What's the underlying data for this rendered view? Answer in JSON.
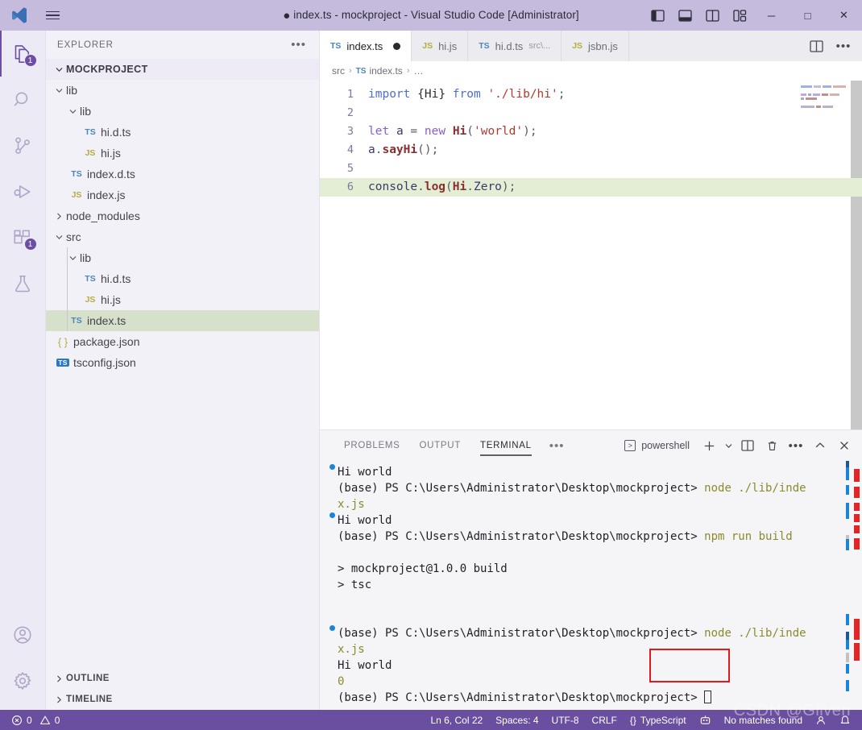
{
  "window": {
    "title": "index.ts - mockproject - Visual Studio Code [Administrator]",
    "dirty_marker": "●",
    "minimize": "─",
    "maximize": "□",
    "close": "✕",
    "titlebar_color": "#c4bbdd"
  },
  "activitybar": {
    "items": [
      {
        "name": "explorer",
        "badge": "1",
        "active": true
      },
      {
        "name": "search",
        "badge": "",
        "active": false
      },
      {
        "name": "source-control",
        "badge": "",
        "active": false
      },
      {
        "name": "run-and-debug",
        "badge": "",
        "active": false
      },
      {
        "name": "extensions",
        "badge": "1",
        "active": false
      },
      {
        "name": "testing",
        "badge": "",
        "active": false
      }
    ],
    "bottom": [
      {
        "name": "accounts"
      },
      {
        "name": "manage-settings"
      }
    ]
  },
  "sidebar": {
    "header": "EXPLORER",
    "more_label": "•••",
    "root": "MOCKPROJECT",
    "tree": [
      {
        "label": "lib",
        "kind": "folder",
        "indent": 1,
        "expanded": true,
        "selected": false
      },
      {
        "label": "lib",
        "kind": "folder",
        "indent": 2,
        "expanded": true,
        "selected": false
      },
      {
        "label": "hi.d.ts",
        "kind": "ts",
        "indent": 3,
        "selected": false
      },
      {
        "label": "hi.js",
        "kind": "js",
        "indent": 3,
        "selected": false
      },
      {
        "label": "index.d.ts",
        "kind": "ts",
        "indent": 2,
        "selected": false
      },
      {
        "label": "index.js",
        "kind": "js",
        "indent": 2,
        "selected": false
      },
      {
        "label": "node_modules",
        "kind": "folder",
        "indent": 1,
        "expanded": false,
        "selected": false
      },
      {
        "label": "src",
        "kind": "folder",
        "indent": 1,
        "expanded": true,
        "selected": false
      },
      {
        "label": "lib",
        "kind": "folder",
        "indent": 2,
        "expanded": true,
        "selected": false
      },
      {
        "label": "hi.d.ts",
        "kind": "ts",
        "indent": 3,
        "selected": false
      },
      {
        "label": "hi.js",
        "kind": "js",
        "indent": 3,
        "selected": false
      },
      {
        "label": "index.ts",
        "kind": "ts",
        "indent": 2,
        "selected": true
      },
      {
        "label": "package.json",
        "kind": "json",
        "indent": 1,
        "selected": false
      },
      {
        "label": "tsconfig.json",
        "kind": "tsconf",
        "indent": 1,
        "selected": false
      }
    ],
    "sections": [
      {
        "label": "OUTLINE"
      },
      {
        "label": "TIMELINE"
      }
    ]
  },
  "editor": {
    "tabs": [
      {
        "label": "index.ts",
        "icon": "TS",
        "desc": "",
        "active": true,
        "dirty": true
      },
      {
        "label": "hi.js",
        "icon": "JS",
        "desc": "",
        "active": false,
        "dirty": false
      },
      {
        "label": "hi.d.ts",
        "icon": "TS",
        "desc": "src\\...",
        "active": false,
        "dirty": false
      },
      {
        "label": "jsbn.js",
        "icon": "JS",
        "desc": "",
        "active": false,
        "dirty": false
      }
    ],
    "actions": [
      {
        "name": "split-editor-right"
      },
      {
        "name": "more-editor-actions",
        "label": "•••"
      }
    ],
    "breadcrumb": [
      {
        "label": "src",
        "icon": ""
      },
      {
        "label": "index.ts",
        "icon": "TS"
      },
      {
        "label": "…",
        "icon": ""
      }
    ],
    "lines": [
      {
        "num": "1",
        "highlight": false,
        "tokens": [
          {
            "t": "import",
            "c": "k-import"
          },
          {
            "t": " ",
            "c": "k-plain"
          },
          {
            "t": "{Hi}",
            "c": "k-plain"
          },
          {
            "t": " ",
            "c": "k-plain"
          },
          {
            "t": "from",
            "c": "k-import"
          },
          {
            "t": " ",
            "c": "k-plain"
          },
          {
            "t": "'./lib/hi'",
            "c": "k-str"
          },
          {
            "t": ";",
            "c": "k-punc"
          }
        ]
      },
      {
        "num": "2",
        "highlight": false,
        "tokens": []
      },
      {
        "num": "3",
        "highlight": false,
        "tokens": [
          {
            "t": "let",
            "c": "k-kw"
          },
          {
            "t": " ",
            "c": "k-plain"
          },
          {
            "t": "a",
            "c": "k-var"
          },
          {
            "t": " = ",
            "c": "k-punc"
          },
          {
            "t": "new",
            "c": "k-kw"
          },
          {
            "t": " ",
            "c": "k-plain"
          },
          {
            "t": "Hi",
            "c": "k-cls"
          },
          {
            "t": "(",
            "c": "k-punc"
          },
          {
            "t": "'world'",
            "c": "k-str"
          },
          {
            "t": ")",
            "c": "k-punc"
          },
          {
            "t": ";",
            "c": "k-punc"
          }
        ]
      },
      {
        "num": "4",
        "highlight": false,
        "tokens": [
          {
            "t": "a",
            "c": "k-var"
          },
          {
            "t": ".",
            "c": "k-punc"
          },
          {
            "t": "sayHi",
            "c": "k-fn"
          },
          {
            "t": "()",
            "c": "k-punc"
          },
          {
            "t": ";",
            "c": "k-punc"
          }
        ]
      },
      {
        "num": "5",
        "highlight": false,
        "tokens": []
      },
      {
        "num": "6",
        "highlight": true,
        "tokens": [
          {
            "t": "console",
            "c": "k-prop"
          },
          {
            "t": ".",
            "c": "k-punc"
          },
          {
            "t": "log",
            "c": "k-fn"
          },
          {
            "t": "(",
            "c": "k-punc"
          },
          {
            "t": "Hi",
            "c": "k-cls"
          },
          {
            "t": ".",
            "c": "k-punc"
          },
          {
            "t": "Zero",
            "c": "k-prop"
          },
          {
            "t": ")",
            "c": "k-punc"
          },
          {
            "t": ";",
            "c": "k-punc"
          }
        ]
      }
    ]
  },
  "panel": {
    "tabs": [
      {
        "label": "PROBLEMS",
        "active": false
      },
      {
        "label": "OUTPUT",
        "active": false
      },
      {
        "label": "TERMINAL",
        "active": true
      }
    ],
    "more_label": "•••",
    "terminal_name": "powershell",
    "actions": [
      {
        "name": "new-terminal",
        "label": "+"
      },
      {
        "name": "terminal-dropdown",
        "label": "⌄"
      },
      {
        "name": "split-terminal",
        "label": ""
      },
      {
        "name": "kill-terminal",
        "label": ""
      },
      {
        "name": "terminal-more",
        "label": "•••"
      },
      {
        "name": "maximize-panel",
        "label": "⌃"
      },
      {
        "name": "close-panel",
        "label": "✕"
      }
    ],
    "terminal_lines": [
      {
        "marker": true,
        "cont": false,
        "parts": [
          {
            "t": "Hi world",
            "c": "t-out"
          }
        ]
      },
      {
        "marker": false,
        "cont": false,
        "parts": [
          {
            "t": "(base) PS C:\\Users\\Administrator\\Desktop\\mockproject> ",
            "c": "t-out"
          },
          {
            "t": "node ./lib/inde",
            "c": "t-cmd"
          }
        ]
      },
      {
        "marker": false,
        "cont": true,
        "parts": [
          {
            "t": "x.js",
            "c": "t-cmd"
          }
        ]
      },
      {
        "marker": true,
        "cont": false,
        "parts": [
          {
            "t": "Hi world",
            "c": "t-out"
          }
        ]
      },
      {
        "marker": false,
        "cont": false,
        "parts": [
          {
            "t": "(base) PS C:\\Users\\Administrator\\Desktop\\mockproject> ",
            "c": "t-out"
          },
          {
            "t": "npm run build",
            "c": "t-cmd"
          }
        ]
      },
      {
        "marker": false,
        "cont": false,
        "parts": []
      },
      {
        "marker": false,
        "cont": false,
        "parts": [
          {
            "t": "> mockproject@1.0.0 build",
            "c": "t-out"
          }
        ]
      },
      {
        "marker": false,
        "cont": false,
        "parts": [
          {
            "t": "> tsc",
            "c": "t-out"
          }
        ]
      },
      {
        "marker": false,
        "cont": false,
        "parts": []
      },
      {
        "marker": false,
        "cont": false,
        "parts": []
      },
      {
        "marker": true,
        "cont": false,
        "parts": [
          {
            "t": "(base) PS C:\\Users\\Administrator\\Desktop\\mockproject> ",
            "c": "t-out"
          },
          {
            "t": "node ./lib/inde",
            "c": "t-cmd"
          }
        ]
      },
      {
        "marker": false,
        "cont": true,
        "parts": [
          {
            "t": "x.js",
            "c": "t-cmd"
          }
        ]
      },
      {
        "marker": false,
        "cont": true,
        "parts": [
          {
            "t": "Hi world",
            "c": "t-out"
          }
        ]
      },
      {
        "marker": false,
        "cont": true,
        "parts": [
          {
            "t": "0",
            "c": "t-num"
          }
        ]
      },
      {
        "marker": false,
        "cont": false,
        "parts": [
          {
            "t": "(base) PS C:\\Users\\Administrator\\Desktop\\mockproject> ",
            "c": "t-out"
          }
        ],
        "cursor": true
      }
    ],
    "annotation_color": "#e01b1b"
  },
  "statusbar": {
    "errors": "0",
    "warnings": "0",
    "position": "Ln 6, Col 22",
    "indentation": "Spaces: 4",
    "encoding": "UTF-8",
    "eol": "CRLF",
    "language": "TypeScript",
    "language_icon": "{}",
    "search_status": "No matches found",
    "background": "#6a4fa0"
  },
  "watermark": "CSDN @Gliven"
}
